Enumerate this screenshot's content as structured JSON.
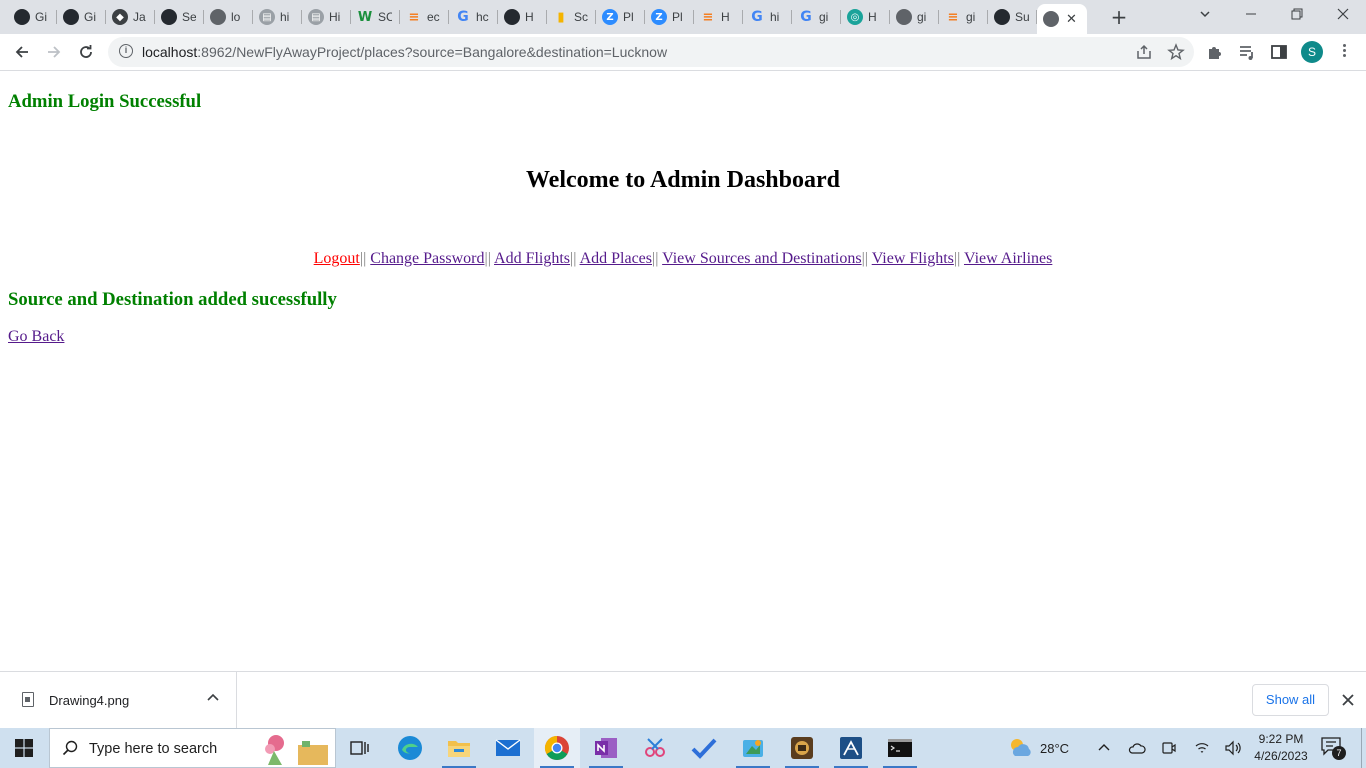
{
  "browser": {
    "tabs": [
      {
        "title": "Gi",
        "icon": "github-icon"
      },
      {
        "title": "Gi",
        "icon": "github-icon"
      },
      {
        "title": "Ja",
        "icon": "diamond-icon"
      },
      {
        "title": "Se",
        "icon": "github-icon"
      },
      {
        "title": "lo",
        "icon": "globe-icon"
      },
      {
        "title": "hi",
        "icon": "page-icon"
      },
      {
        "title": "Hi",
        "icon": "page-icon"
      },
      {
        "title": "SC",
        "icon": "w-icon"
      },
      {
        "title": "ec",
        "icon": "stackoverflow-icon"
      },
      {
        "title": "hc",
        "icon": "google-icon"
      },
      {
        "title": "H",
        "icon": "github-icon"
      },
      {
        "title": "Sc",
        "icon": "chart-icon"
      },
      {
        "title": "Pl",
        "icon": "z-icon"
      },
      {
        "title": "Pl",
        "icon": "z-icon"
      },
      {
        "title": "H",
        "icon": "stackoverflow-icon"
      },
      {
        "title": "hi",
        "icon": "google-icon"
      },
      {
        "title": "gi",
        "icon": "google-icon"
      },
      {
        "title": "H",
        "icon": "eye-icon"
      },
      {
        "title": "gi",
        "icon": "globe-icon"
      },
      {
        "title": "gi",
        "icon": "stackoverflow-icon"
      },
      {
        "title": "Su",
        "icon": "github-icon"
      },
      {
        "title": "",
        "icon": "globe-icon",
        "active": true
      }
    ],
    "url_host": "localhost",
    "url_path": ":8962/NewFlyAwayProject/places?source=Bangalore&destination=Lucknow",
    "profile_initial": "S"
  },
  "page": {
    "login_message": "Admin Login Successful",
    "welcome_heading": "Welcome to Admin Dashboard",
    "nav": {
      "logout": "Logout",
      "change_password": "Change Password",
      "add_flights": "Add Flights",
      "add_places": "Add Places",
      "view_sources": "View Sources and Destinations",
      "view_flights": "View Flights",
      "view_airlines": "View Airlines",
      "separator": "||"
    },
    "success_message": "Source and Destination added sucessfully",
    "go_back": "Go Back"
  },
  "downloads": {
    "file_name": "Drawing4.png",
    "show_all": "Show all"
  },
  "taskbar": {
    "search_placeholder": "Type here to search",
    "weather": "28°C",
    "time": "9:22 PM",
    "date": "4/26/2023",
    "notification_count": "7"
  },
  "colors": {
    "success_green": "#008000",
    "logout_red": "#ff0000",
    "link_visited": "#551a8b",
    "tabstrip_bg": "#dee1e6",
    "taskbar_bg": "#cfe0ef"
  }
}
